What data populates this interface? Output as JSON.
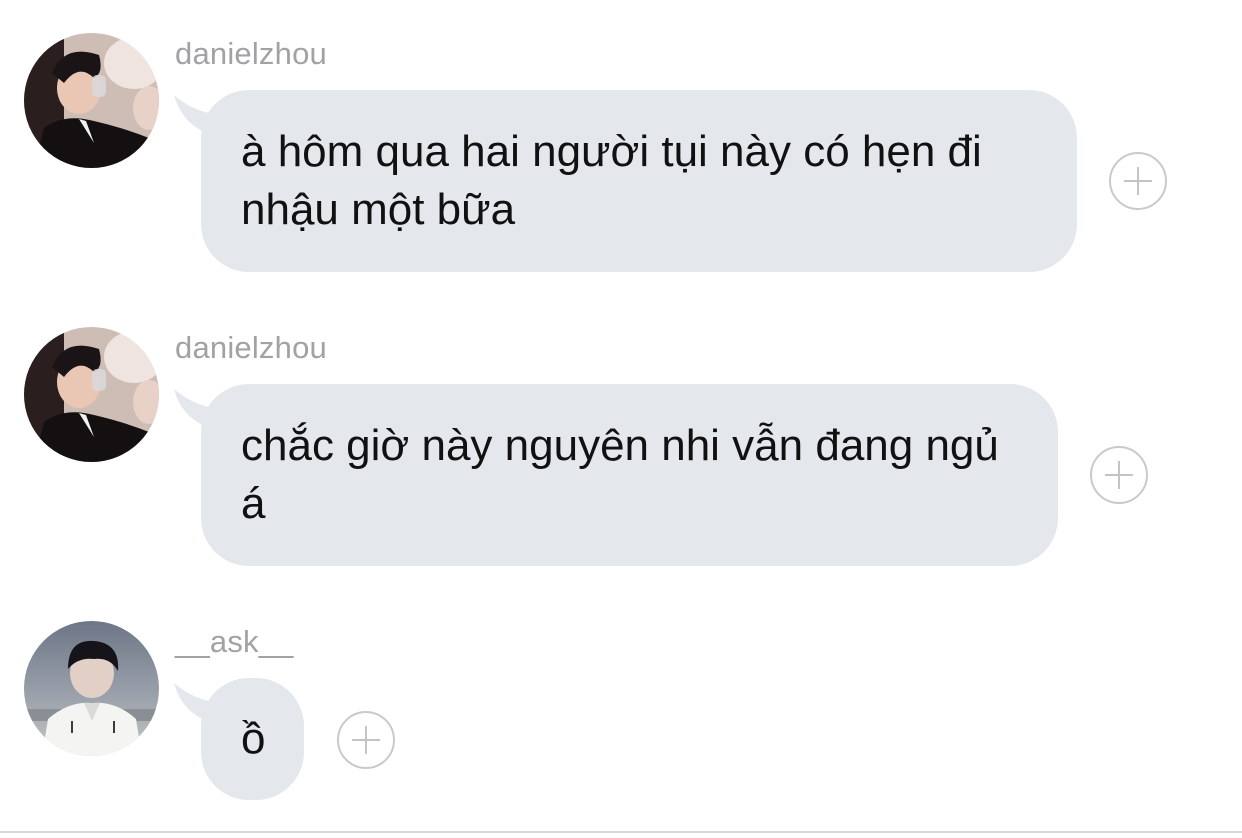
{
  "messages": [
    {
      "username": "danielzhou",
      "text": "à hôm qua hai người tụi này có hẹn đi nhậu một bữa"
    },
    {
      "username": "danielzhou",
      "text": "chắc giờ này nguyên nhi vẫn đang ngủ á"
    },
    {
      "username": "__ask__",
      "text": "ồ"
    }
  ],
  "colors": {
    "bubble": "#e4e8ec",
    "username": "#a2a2a6",
    "plus_outline": "#c9c9cc"
  },
  "icons": {
    "react": "plus-circle-icon"
  }
}
